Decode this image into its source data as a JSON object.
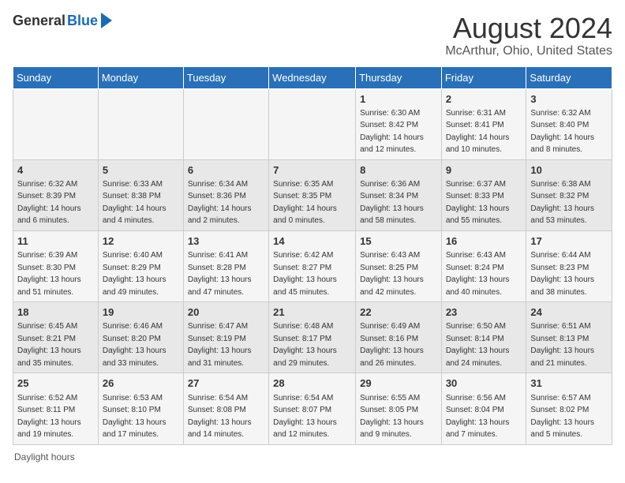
{
  "header": {
    "logo_general": "General",
    "logo_blue": "Blue",
    "title": "August 2024",
    "subtitle": "McArthur, Ohio, United States"
  },
  "weekdays": [
    "Sunday",
    "Monday",
    "Tuesday",
    "Wednesday",
    "Thursday",
    "Friday",
    "Saturday"
  ],
  "weeks": [
    [
      {
        "day": "",
        "sunrise": "",
        "sunset": "",
        "daylight": ""
      },
      {
        "day": "",
        "sunrise": "",
        "sunset": "",
        "daylight": ""
      },
      {
        "day": "",
        "sunrise": "",
        "sunset": "",
        "daylight": ""
      },
      {
        "day": "",
        "sunrise": "",
        "sunset": "",
        "daylight": ""
      },
      {
        "day": "1",
        "sunrise": "Sunrise: 6:30 AM",
        "sunset": "Sunset: 8:42 PM",
        "daylight": "Daylight: 14 hours and 12 minutes."
      },
      {
        "day": "2",
        "sunrise": "Sunrise: 6:31 AM",
        "sunset": "Sunset: 8:41 PM",
        "daylight": "Daylight: 14 hours and 10 minutes."
      },
      {
        "day": "3",
        "sunrise": "Sunrise: 6:32 AM",
        "sunset": "Sunset: 8:40 PM",
        "daylight": "Daylight: 14 hours and 8 minutes."
      }
    ],
    [
      {
        "day": "4",
        "sunrise": "Sunrise: 6:32 AM",
        "sunset": "Sunset: 8:39 PM",
        "daylight": "Daylight: 14 hours and 6 minutes."
      },
      {
        "day": "5",
        "sunrise": "Sunrise: 6:33 AM",
        "sunset": "Sunset: 8:38 PM",
        "daylight": "Daylight: 14 hours and 4 minutes."
      },
      {
        "day": "6",
        "sunrise": "Sunrise: 6:34 AM",
        "sunset": "Sunset: 8:36 PM",
        "daylight": "Daylight: 14 hours and 2 minutes."
      },
      {
        "day": "7",
        "sunrise": "Sunrise: 6:35 AM",
        "sunset": "Sunset: 8:35 PM",
        "daylight": "Daylight: 14 hours and 0 minutes."
      },
      {
        "day": "8",
        "sunrise": "Sunrise: 6:36 AM",
        "sunset": "Sunset: 8:34 PM",
        "daylight": "Daylight: 13 hours and 58 minutes."
      },
      {
        "day": "9",
        "sunrise": "Sunrise: 6:37 AM",
        "sunset": "Sunset: 8:33 PM",
        "daylight": "Daylight: 13 hours and 55 minutes."
      },
      {
        "day": "10",
        "sunrise": "Sunrise: 6:38 AM",
        "sunset": "Sunset: 8:32 PM",
        "daylight": "Daylight: 13 hours and 53 minutes."
      }
    ],
    [
      {
        "day": "11",
        "sunrise": "Sunrise: 6:39 AM",
        "sunset": "Sunset: 8:30 PM",
        "daylight": "Daylight: 13 hours and 51 minutes."
      },
      {
        "day": "12",
        "sunrise": "Sunrise: 6:40 AM",
        "sunset": "Sunset: 8:29 PM",
        "daylight": "Daylight: 13 hours and 49 minutes."
      },
      {
        "day": "13",
        "sunrise": "Sunrise: 6:41 AM",
        "sunset": "Sunset: 8:28 PM",
        "daylight": "Daylight: 13 hours and 47 minutes."
      },
      {
        "day": "14",
        "sunrise": "Sunrise: 6:42 AM",
        "sunset": "Sunset: 8:27 PM",
        "daylight": "Daylight: 13 hours and 45 minutes."
      },
      {
        "day": "15",
        "sunrise": "Sunrise: 6:43 AM",
        "sunset": "Sunset: 8:25 PM",
        "daylight": "Daylight: 13 hours and 42 minutes."
      },
      {
        "day": "16",
        "sunrise": "Sunrise: 6:43 AM",
        "sunset": "Sunset: 8:24 PM",
        "daylight": "Daylight: 13 hours and 40 minutes."
      },
      {
        "day": "17",
        "sunrise": "Sunrise: 6:44 AM",
        "sunset": "Sunset: 8:23 PM",
        "daylight": "Daylight: 13 hours and 38 minutes."
      }
    ],
    [
      {
        "day": "18",
        "sunrise": "Sunrise: 6:45 AM",
        "sunset": "Sunset: 8:21 PM",
        "daylight": "Daylight: 13 hours and 35 minutes."
      },
      {
        "day": "19",
        "sunrise": "Sunrise: 6:46 AM",
        "sunset": "Sunset: 8:20 PM",
        "daylight": "Daylight: 13 hours and 33 minutes."
      },
      {
        "day": "20",
        "sunrise": "Sunrise: 6:47 AM",
        "sunset": "Sunset: 8:19 PM",
        "daylight": "Daylight: 13 hours and 31 minutes."
      },
      {
        "day": "21",
        "sunrise": "Sunrise: 6:48 AM",
        "sunset": "Sunset: 8:17 PM",
        "daylight": "Daylight: 13 hours and 29 minutes."
      },
      {
        "day": "22",
        "sunrise": "Sunrise: 6:49 AM",
        "sunset": "Sunset: 8:16 PM",
        "daylight": "Daylight: 13 hours and 26 minutes."
      },
      {
        "day": "23",
        "sunrise": "Sunrise: 6:50 AM",
        "sunset": "Sunset: 8:14 PM",
        "daylight": "Daylight: 13 hours and 24 minutes."
      },
      {
        "day": "24",
        "sunrise": "Sunrise: 6:51 AM",
        "sunset": "Sunset: 8:13 PM",
        "daylight": "Daylight: 13 hours and 21 minutes."
      }
    ],
    [
      {
        "day": "25",
        "sunrise": "Sunrise: 6:52 AM",
        "sunset": "Sunset: 8:11 PM",
        "daylight": "Daylight: 13 hours and 19 minutes."
      },
      {
        "day": "26",
        "sunrise": "Sunrise: 6:53 AM",
        "sunset": "Sunset: 8:10 PM",
        "daylight": "Daylight: 13 hours and 17 minutes."
      },
      {
        "day": "27",
        "sunrise": "Sunrise: 6:54 AM",
        "sunset": "Sunset: 8:08 PM",
        "daylight": "Daylight: 13 hours and 14 minutes."
      },
      {
        "day": "28",
        "sunrise": "Sunrise: 6:54 AM",
        "sunset": "Sunset: 8:07 PM",
        "daylight": "Daylight: 13 hours and 12 minutes."
      },
      {
        "day": "29",
        "sunrise": "Sunrise: 6:55 AM",
        "sunset": "Sunset: 8:05 PM",
        "daylight": "Daylight: 13 hours and 9 minutes."
      },
      {
        "day": "30",
        "sunrise": "Sunrise: 6:56 AM",
        "sunset": "Sunset: 8:04 PM",
        "daylight": "Daylight: 13 hours and 7 minutes."
      },
      {
        "day": "31",
        "sunrise": "Sunrise: 6:57 AM",
        "sunset": "Sunset: 8:02 PM",
        "daylight": "Daylight: 13 hours and 5 minutes."
      }
    ]
  ],
  "footer": {
    "label": "Daylight hours"
  }
}
